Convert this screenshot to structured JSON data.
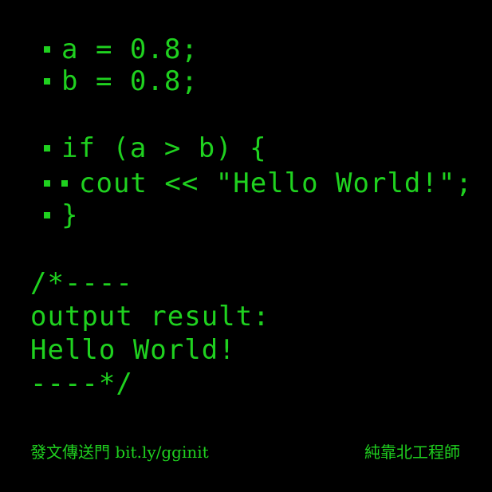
{
  "code": {
    "lines": [
      "a = 0.8;",
      "b = 0.8;",
      "if (a > b) {",
      "cout << \"Hello World!\";",
      "}"
    ]
  },
  "output": {
    "lines": [
      "/*----",
      "output result:",
      "Hello World!",
      "----*/"
    ]
  },
  "footer": {
    "left": "發文傳送門 bit.ly/gginit",
    "right": "純靠北工程師"
  },
  "colors": {
    "background": "#000000",
    "text": "#1fd11f"
  }
}
